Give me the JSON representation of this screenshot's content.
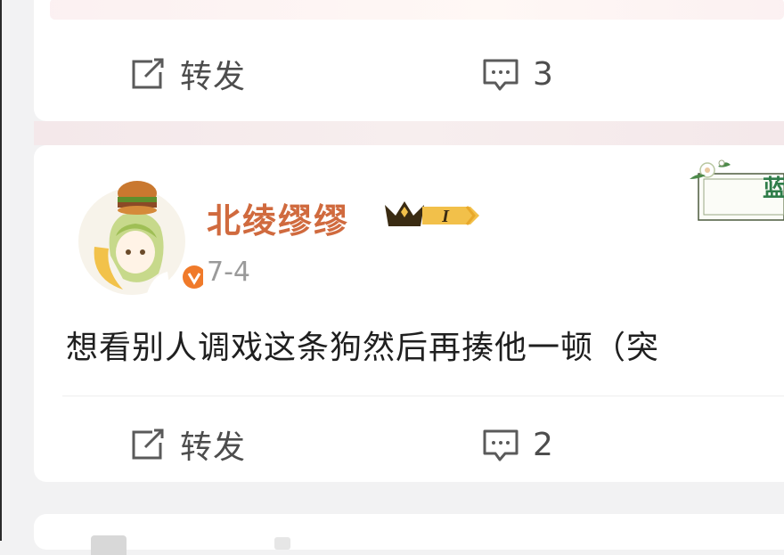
{
  "prev_post": {
    "actions": {
      "repost_label": "转发",
      "comment_count": "3"
    }
  },
  "post": {
    "username": "北绫缪缪",
    "level_badge": "I",
    "time": "7-4",
    "text": "想看别人调戏这条狗然后再揍他一顿（突",
    "decor_badge_text": "蓝",
    "actions": {
      "repost_label": "转发",
      "comment_count": "2"
    }
  },
  "colors": {
    "username": "#d06a3e",
    "verified": "#f07a2a",
    "crown_gold": "#f2c04a",
    "text": "#1f1f1f",
    "icon": "#5a5a5a"
  },
  "icons": [
    "repost-icon",
    "comment-icon",
    "crown-icon",
    "verified-icon",
    "avatar-image",
    "decor-badge"
  ]
}
